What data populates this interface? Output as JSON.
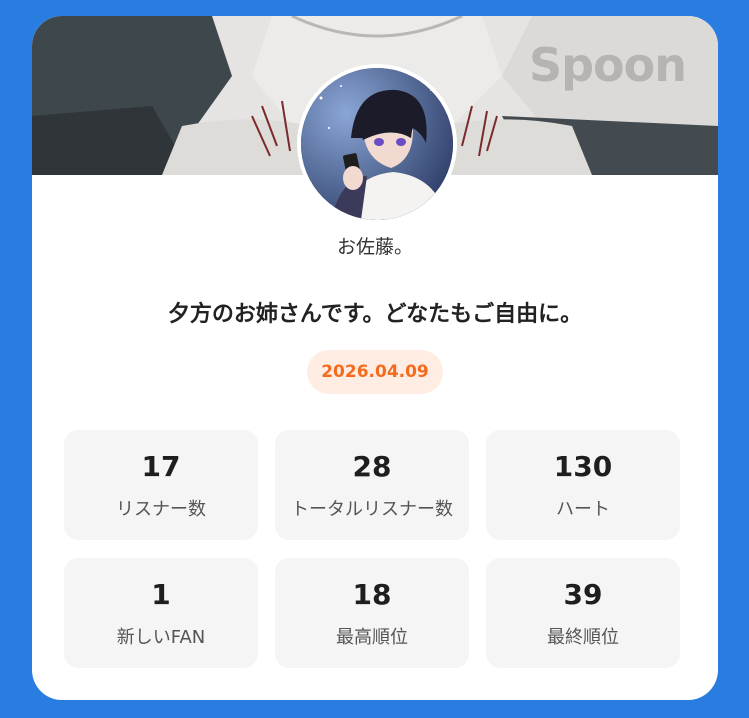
{
  "brand": {
    "logo_text": "Spoon"
  },
  "profile": {
    "username": "お佐藤。",
    "title": "夕方のお姉さんです。どなたもご自由に。",
    "date": "2026.04.09"
  },
  "stats": [
    {
      "value": "17",
      "label": "リスナー数"
    },
    {
      "value": "28",
      "label": "トータルリスナー数"
    },
    {
      "value": "130",
      "label": "ハート"
    },
    {
      "value": "1",
      "label": "新しいFAN"
    },
    {
      "value": "18",
      "label": "最高順位"
    },
    {
      "value": "39",
      "label": "最終順位"
    }
  ],
  "colors": {
    "background": "#2a7de0",
    "card": "#ffffff",
    "date_text": "#f46b1e",
    "date_bg": "#ffece3",
    "stat_bg": "#f5f5f5"
  }
}
